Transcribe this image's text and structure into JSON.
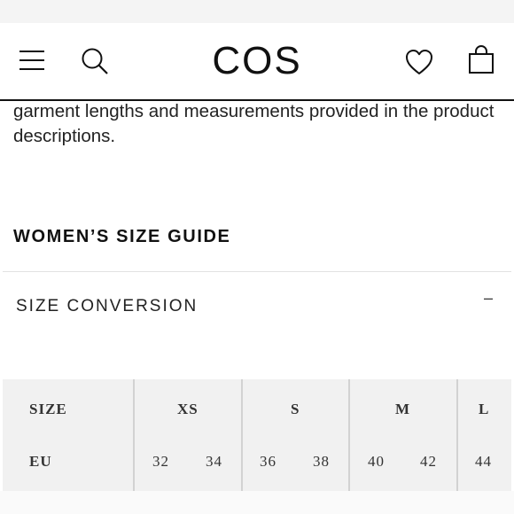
{
  "header": {
    "logo": "COS",
    "icons": [
      "hamburger-menu-icon",
      "search-icon",
      "heart-icon",
      "shopping-bag-icon"
    ]
  },
  "intro_text": "garment lengths and measurements provided in the product descriptions.",
  "guide_title": "WOMEN’S SIZE GUIDE",
  "accordion": {
    "title": "SIZE CONVERSION",
    "toggle": "–",
    "expanded": true
  },
  "size_table": {
    "header_label": "SIZE",
    "sizes": [
      "XS",
      "S",
      "M",
      "L"
    ],
    "rows": [
      {
        "label": "EU",
        "values": [
          "32",
          "34",
          "36",
          "38",
          "40",
          "42",
          "44"
        ]
      }
    ]
  },
  "colors": {
    "text": "#111111",
    "table_background": "#f1f1f1",
    "divider": "#e2e2e2"
  }
}
